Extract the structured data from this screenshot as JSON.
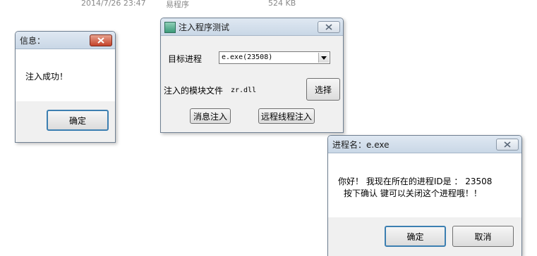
{
  "background_row": {
    "date": "2014/7/26 23:47",
    "type": "易程序",
    "size": "524 KB"
  },
  "info_dialog": {
    "title": "信息：",
    "message": "注入成功！",
    "ok_label": "确定"
  },
  "inject_dialog": {
    "title": "注入程序测试",
    "target_label": "目标进程",
    "process_value": "e.exe(23508)",
    "module_label": "注入的模块文件",
    "module_value": "zr.dll",
    "browse_label": "选择",
    "message_inject_label": "消息注入",
    "remote_thread_inject_label": "远程线程注入"
  },
  "process_dialog": {
    "title": "进程名：e.exe",
    "line1": "你好！ 我现在所在的进程ID是 ： 23508",
    "line2": "按下确认 键可以关闭这个进程哦！！",
    "ok_label": "确定",
    "cancel_label": "取消"
  },
  "colors": {
    "titlebar": "#c9d7e6",
    "close_red": "#c4422a",
    "default_button_border": "#3c7fb1"
  }
}
